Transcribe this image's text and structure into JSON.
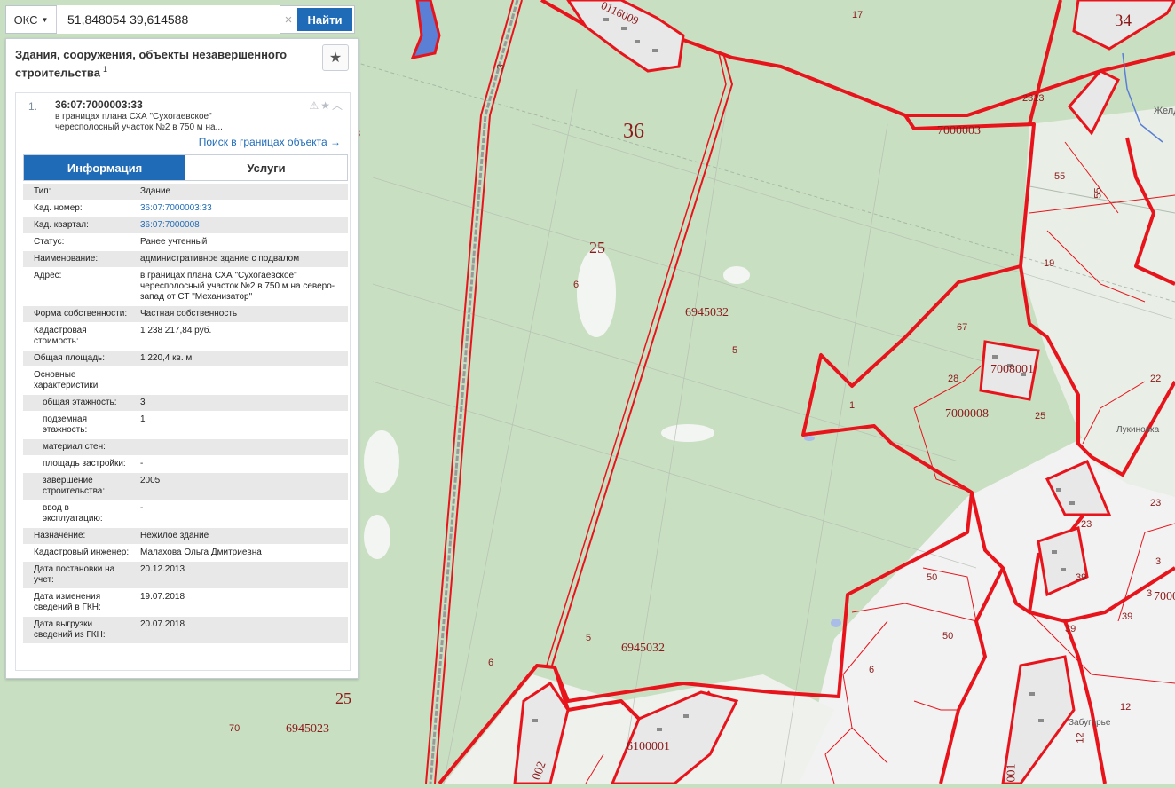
{
  "search": {
    "type_label": "ОКС",
    "value": "51,848054 39,614588",
    "clear_icon": "close-icon",
    "button_label": "Найти"
  },
  "panel": {
    "title": "Здания, сооружения, объекты незавершенного строительства",
    "title_sup": "1",
    "favorite_icon": "star-icon",
    "card": {
      "number": "1.",
      "cad_number": "36:07:7000003:33",
      "address_short": "в границах плана СХА \"Сухогаевское\" чересполосный участок №2 в 750 м на...",
      "icons": "warning-icon star-icon chevron-up-icon",
      "search_link": "Поиск в границах объекта →"
    },
    "tabs": {
      "info": "Информация",
      "services": "Услуги"
    },
    "props": [
      {
        "k": "Тип:",
        "v": "Здание"
      },
      {
        "k": "Кад. номер:",
        "v": "36:07:7000003:33",
        "link": true
      },
      {
        "k": "Кад. квартал:",
        "v": "36:07:7000008",
        "link": true
      },
      {
        "k": "Статус:",
        "v": "Ранее учтенный"
      },
      {
        "k": "Наименование:",
        "v": "административное здание с подвалом"
      },
      {
        "k": "Адрес:",
        "v": "в границах плана СХА \"Сухогаевское\" чересполосный участок №2 в 750 м на северо-запад от СТ \"Механизатор\""
      },
      {
        "k": "Форма собственности:",
        "v": "Частная собственность"
      },
      {
        "k": "Кадастровая стоимость:",
        "v": "1 238 217,84 руб."
      },
      {
        "k": "Общая площадь:",
        "v": "1 220,4 кв. м"
      },
      {
        "k": "Основные характеристики",
        "v": ""
      },
      {
        "k": "общая этажность:",
        "v": "3",
        "sub": true
      },
      {
        "k": "подземная этажность:",
        "v": "1",
        "sub": true
      },
      {
        "k": "материал стен:",
        "v": "",
        "sub": true
      },
      {
        "k": "площадь застройки:",
        "v": "-",
        "sub": true
      },
      {
        "k": "завершение строительства:",
        "v": "2005",
        "sub": true
      },
      {
        "k": "ввод в эксплуатацию:",
        "v": "-",
        "sub": true
      },
      {
        "k": "Назначение:",
        "v": "Нежилое здание"
      },
      {
        "k": "Кадастровый инженер:",
        "v": "Малахова Ольга Дмитриевна"
      },
      {
        "k": "Дата постановки на учет:",
        "v": "20.12.2013"
      },
      {
        "k": "Дата изменения сведений в ГКН:",
        "v": "19.07.2018"
      },
      {
        "k": "Дата выгрузки сведений из ГКН:",
        "v": "20.07.2018"
      }
    ]
  },
  "map": {
    "labels": {
      "q17": "17",
      "q34": "34",
      "q116009": "0116009",
      "q36": "36",
      "q7000003": "7000003",
      "q2313": "2313",
      "q55a": "55",
      "q55b": "55",
      "q25a": "25",
      "q6a": "6",
      "q6945032a": "6945032",
      "q5a": "5",
      "q19": "19",
      "q67": "67",
      "q7008001": "7008001",
      "q28": "28",
      "q22": "22",
      "q1": "1",
      "q7000008": "7000008",
      "q25b": "25",
      "luk": "Лукиновка",
      "q23": "23",
      "q3a": "3",
      "q23b": "23",
      "q39a": "39",
      "q39b": "39",
      "q39c": "39",
      "q3b": "3",
      "q7000": "7000",
      "q50a": "50",
      "q50b": "50",
      "q5b": "5",
      "q6945032b": "6945032",
      "q6b": "6",
      "q6c": "6",
      "q25c": "25",
      "q70": "70",
      "q6945023": "6945023",
      "q6100001": "6100001",
      "q002": "002",
      "q001": "001",
      "zab": "Забугорье",
      "q12a": "12",
      "q12b": "12",
      "q3c": "3",
      "zhel": "Желд",
      "q33": "3"
    },
    "colors": {
      "background": "#c9dfc2",
      "boundary": "#e8141c",
      "water": "#5a7fd4",
      "urban": "#f2f2f2"
    }
  }
}
